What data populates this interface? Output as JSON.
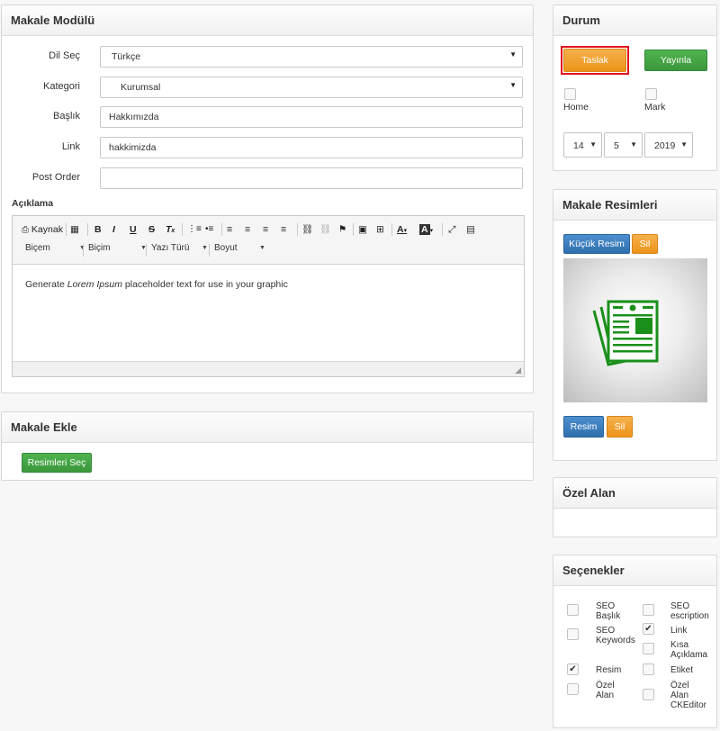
{
  "makale_modulu": {
    "title": "Makale Modülü",
    "fields": {
      "dil_sec": {
        "label": "Dil Seç",
        "value": "Türkçe"
      },
      "kategori": {
        "label": "Kategori",
        "value": "Kurumsal"
      },
      "baslik": {
        "label": "Başlık",
        "value": "Hakkımızda"
      },
      "link": {
        "label": "Link",
        "value": "hakkimizda"
      },
      "post_order": {
        "label": "Post Order",
        "value": ""
      }
    },
    "aciklama_label": "Açıklama",
    "editor": {
      "source_label": "Kaynak",
      "combo_format": "Biçem",
      "combo_style": "Biçim",
      "combo_font": "Yazı Türü",
      "combo_size": "Boyut",
      "content_before": "Generate ",
      "content_italic": "Lorem Ipsum",
      "content_after": " placeholder text for use in your graphic"
    }
  },
  "makale_ekle": {
    "title": "Makale Ekle",
    "select_images_button": "Resimleri Seç"
  },
  "durum": {
    "title": "Durum",
    "draft_button": "Taslak",
    "publish_button": "Yayınla",
    "home_label": "Home",
    "mark_label": "Mark",
    "day": "14",
    "month": "5",
    "year": "2019"
  },
  "makale_resimleri": {
    "title": "Makale Resimleri",
    "small_image_button": "Küçük Resim",
    "delete_small": "Sil",
    "image_button": "Resim",
    "delete_image": "Sil",
    "placeholder_icon": "article-icon"
  },
  "ozel_alan": {
    "title": "Özel Alan"
  },
  "secenekler": {
    "title": "Seçenekler",
    "options": [
      {
        "label_line1": "SEO",
        "label_line2": "Başlık",
        "checked": false
      },
      {
        "label_line1": "SEO",
        "label_line2": "escription",
        "checked": false
      },
      {
        "label_line1": "SEO",
        "label_line2": "Keywords",
        "checked": false
      },
      {
        "label_line1": "Link",
        "label_line2": "",
        "checked": true
      },
      {
        "label_line1": "Kısa",
        "label_line2": "Açıklama",
        "checked": false
      },
      {
        "label_line1": "Resim",
        "label_line2": "",
        "checked": true
      },
      {
        "label_line1": "Etiket",
        "label_line2": "",
        "checked": false
      },
      {
        "label_line1": "Özel",
        "label_line2": "Alan",
        "checked": false
      },
      {
        "label_line1": "Özel",
        "label_line2": "Alan",
        "label_line3": "CKEditor",
        "checked": false
      }
    ]
  },
  "colors": {
    "orange": "#ec9419",
    "green": "#3b973b",
    "blue": "#2f6fae",
    "highlight_border": "#e0141e",
    "article_icon": "#1a8f1a"
  }
}
